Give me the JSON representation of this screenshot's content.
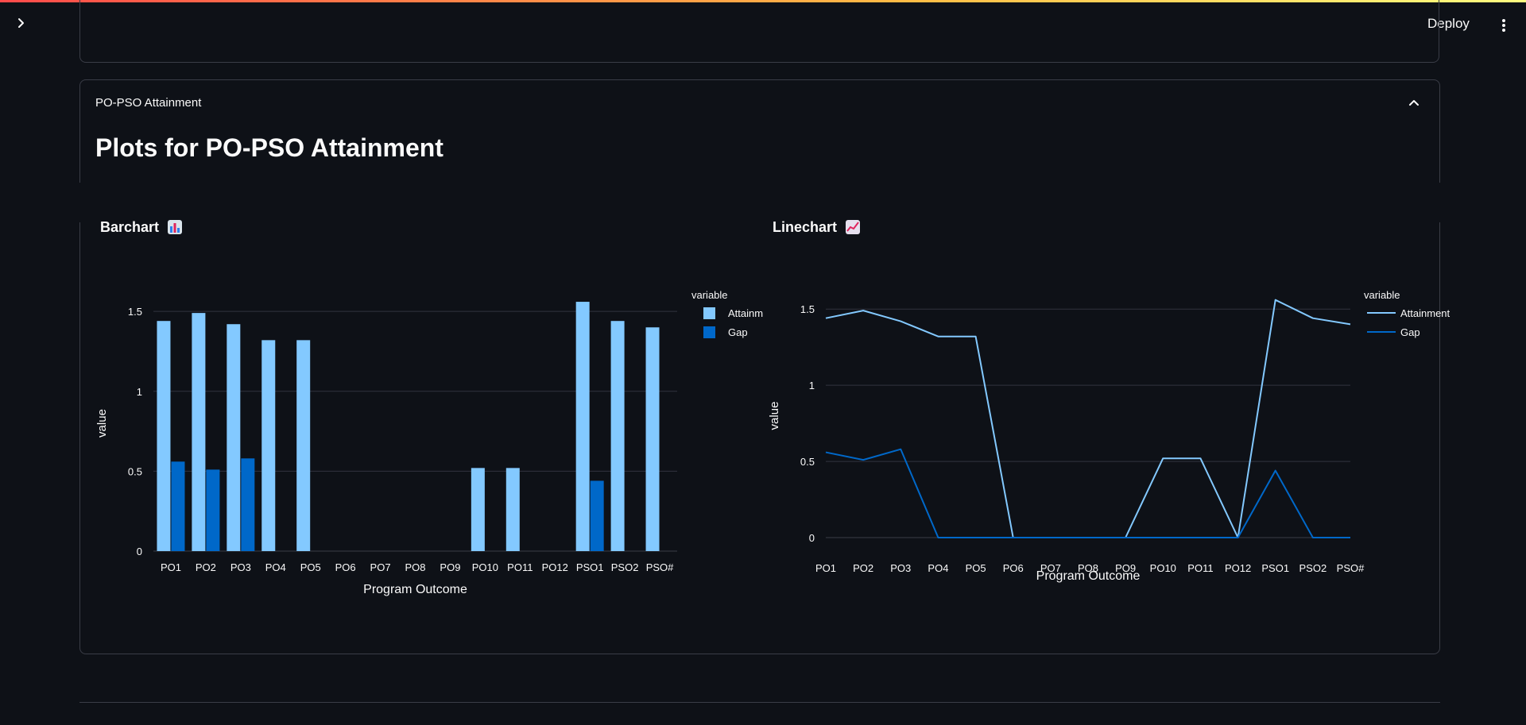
{
  "app": {
    "deploy_label": "Deploy"
  },
  "expander": {
    "header": "PO-PSO Attainment"
  },
  "page": {
    "title": "Plots for PO-PSO Attainment"
  },
  "barchart": {
    "title": "Barchart",
    "emoji": "bar-chart-icon"
  },
  "linechart": {
    "title": "Linechart",
    "emoji": "chart-increasing-icon"
  },
  "colors": {
    "attainment": "#83c9ff",
    "gap": "#0068c9",
    "grid": "#31333f",
    "text": "#fafafa"
  },
  "chart_data": [
    {
      "type": "bar",
      "title": "Barchart",
      "categories": [
        "PO1",
        "PO2",
        "PO3",
        "PO4",
        "PO5",
        "PO6",
        "PO7",
        "PO8",
        "PO9",
        "PO10",
        "PO11",
        "PO12",
        "PSO1",
        "PSO2",
        "PSO#"
      ],
      "series": [
        {
          "name": "Attainment",
          "legend_label": "Attainm",
          "values": [
            1.44,
            1.49,
            1.42,
            1.32,
            1.32,
            0,
            0,
            0,
            0,
            0.52,
            0.52,
            0,
            1.56,
            1.44,
            1.4
          ]
        },
        {
          "name": "Gap",
          "legend_label": "Gap",
          "values": [
            0.56,
            0.51,
            0.58,
            0,
            0,
            0,
            0,
            0,
            0,
            0,
            0,
            0,
            0.44,
            0,
            0
          ]
        }
      ],
      "xlabel": "Program Outcome",
      "ylabel": "value",
      "ylim": [
        0,
        1.6
      ],
      "yticks": [
        0,
        0.5,
        1,
        1.5
      ],
      "ytick_labels": [
        "0",
        "0.5",
        "1",
        "1.5"
      ],
      "legend_title": "variable",
      "legend_position": "right",
      "grid": true
    },
    {
      "type": "line",
      "title": "Linechart",
      "categories": [
        "PO1",
        "PO2",
        "PO3",
        "PO4",
        "PO5",
        "PO6",
        "PO7",
        "PO8",
        "PO9",
        "PO10",
        "PO11",
        "PO12",
        "PSO1",
        "PSO2",
        "PSO#"
      ],
      "series": [
        {
          "name": "Attainment",
          "legend_label": "Attainment",
          "values": [
            1.44,
            1.49,
            1.42,
            1.32,
            1.32,
            0,
            0,
            0,
            0,
            0.52,
            0.52,
            0,
            1.56,
            1.44,
            1.4
          ]
        },
        {
          "name": "Gap",
          "legend_label": "Gap",
          "values": [
            0.56,
            0.51,
            0.58,
            0,
            0,
            0,
            0,
            0,
            0,
            0,
            0,
            0,
            0.44,
            0,
            0
          ]
        }
      ],
      "xlabel": "Program Outcome",
      "ylabel": "value",
      "ylim": [
        0,
        1.6
      ],
      "yticks": [
        0,
        0.5,
        1,
        1.5
      ],
      "ytick_labels": [
        "0",
        "0.5",
        "1",
        "1.5"
      ],
      "legend_title": "variable",
      "legend_position": "right",
      "grid": true
    }
  ]
}
